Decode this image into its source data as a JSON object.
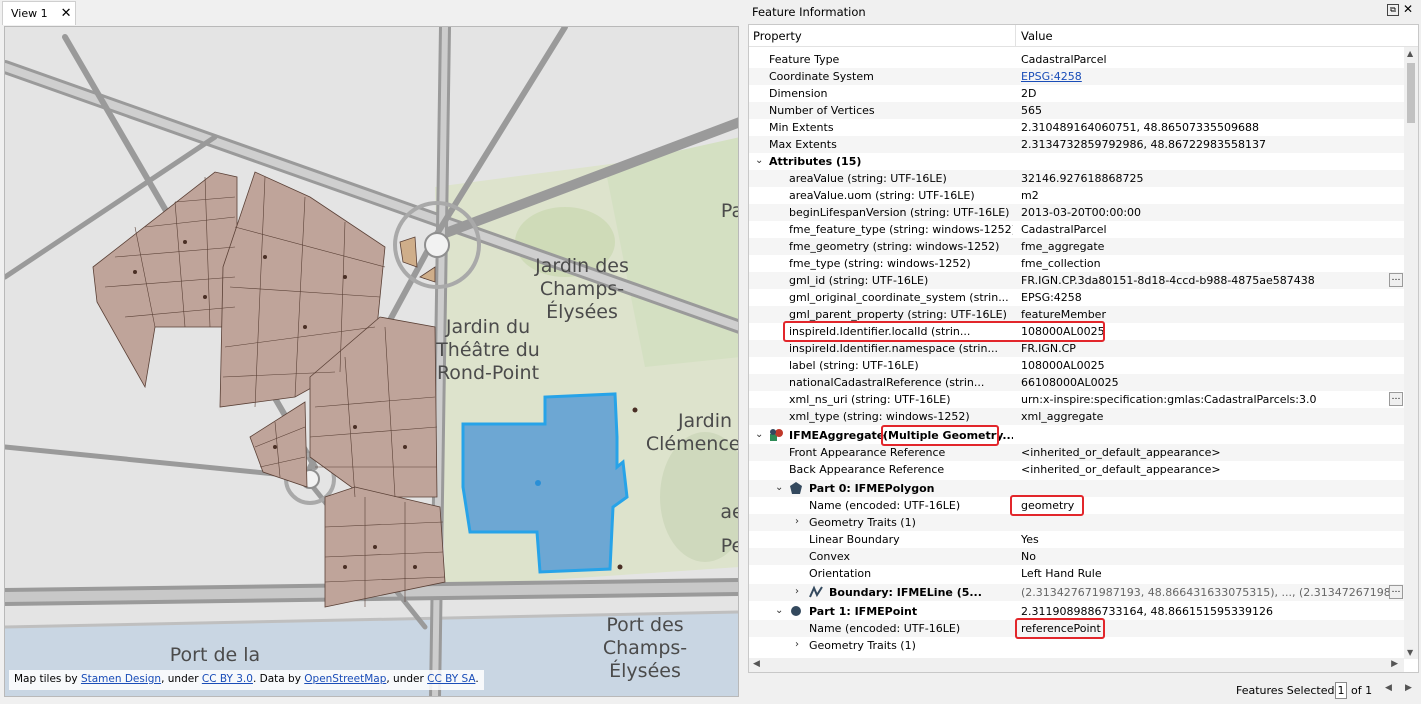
{
  "view_tab": {
    "label": "View 1"
  },
  "map": {
    "labels": {
      "jardin_champs": [
        "Jardin des",
        "Champs-",
        "Élysées"
      ],
      "jardin_theatre": [
        "Jardin du",
        "Théâtre du",
        "Rond-Point"
      ],
      "jardin_clemenceau": [
        "Jardin",
        "Clémenceau"
      ],
      "port": [
        "Port des",
        "Champs-",
        "Élysées"
      ],
      "port_de_la": [
        "Port de la"
      ],
      "edge_pa": "Pa",
      "edge_ae": "ae",
      "edge_pe": "Pe"
    },
    "attribution": {
      "t1": "Map tiles by ",
      "l1": "Stamen Design",
      "t2": ", under ",
      "l2": "CC BY 3.0",
      "t3": ". Data by ",
      "l3": "OpenStreetMap",
      "t4": ", under ",
      "l4": "CC BY SA",
      "t5": "."
    },
    "colors": {
      "parcel": "#bfa49a",
      "selected": "#6da7d3",
      "selected_outline": "#27a3e8"
    }
  },
  "panel": {
    "title": "Feature Information",
    "col_property": "Property",
    "col_value": "Value",
    "rows": [
      {
        "prop": "Feature Type",
        "val": "CadastralParcel"
      },
      {
        "prop": "Coordinate System",
        "val": "EPSG:4258",
        "link": true
      },
      {
        "prop": "Dimension",
        "val": "2D"
      },
      {
        "prop": "Number of Vertices",
        "val": "565"
      },
      {
        "prop": "Min Extents",
        "val": "2.310489164060751, 48.86507335509688"
      },
      {
        "prop": "Max Extents",
        "val": "2.3134732859792986, 48.86722983558137"
      },
      {
        "prop": "Attributes (15)",
        "val": "",
        "bold": true,
        "expand": true
      },
      {
        "prop": "areaValue (string: UTF-16LE)",
        "val": "32146.927618868725"
      },
      {
        "prop": "areaValue.uom (string: UTF-16LE)",
        "val": "m2"
      },
      {
        "prop": "beginLifespanVersion (string: UTF-16LE)",
        "val": "2013-03-20T00:00:00"
      },
      {
        "prop": "fme_feature_type (string: windows-1252)",
        "val": "CadastralParcel"
      },
      {
        "prop": "fme_geometry (string: windows-1252)",
        "val": "fme_aggregate"
      },
      {
        "prop": "fme_type (string: windows-1252)",
        "val": "fme_collection"
      },
      {
        "prop": "gml_id (string: UTF-16LE)",
        "val": "FR.IGN.CP.3da80151-8d18-4ccd-b988-4875ae587438",
        "btn": true
      },
      {
        "prop": "gml_original_coordinate_system (strin...",
        "val": "EPSG:4258"
      },
      {
        "prop": "gml_parent_property (string: UTF-16LE)",
        "val": "featureMember"
      },
      {
        "prop": "inspireId.Identifier.localId (strin...",
        "val": "108000AL0025"
      },
      {
        "prop": "inspireId.Identifier.namespace (strin...",
        "val": "FR.IGN.CP"
      },
      {
        "prop": "label (string: UTF-16LE)",
        "val": "108000AL0025"
      },
      {
        "prop": "nationalCadastralReference (strin...",
        "val": "66108000AL0025"
      },
      {
        "prop": "xml_ns_uri (string: UTF-16LE)",
        "val": "urn:x-inspire:specification:gmlas:CadastralParcels:3.0",
        "btn": true
      },
      {
        "prop": "xml_type (string: windows-1252)",
        "val": "xml_aggregate"
      },
      {
        "prop": "IFMEAggregate",
        "prop2": "(Multiple Geometry...",
        "val": "",
        "bold": true,
        "expand": true,
        "icon": "aggregate"
      },
      {
        "prop": "Front Appearance Reference",
        "val": "<inherited_or_default_appearance>"
      },
      {
        "prop": "Back Appearance Reference",
        "val": "<inherited_or_default_appearance>"
      },
      {
        "prop": "Part 0: IFMEPolygon",
        "val": "",
        "bold": true,
        "expand": true,
        "icon": "polygon"
      },
      {
        "prop": "Name (encoded: UTF-16LE)",
        "val": "geometry"
      },
      {
        "prop": "Geometry Traits (1)",
        "val": "",
        "collapsed": true
      },
      {
        "prop": "Linear Boundary",
        "val": "Yes"
      },
      {
        "prop": "Convex",
        "val": "No"
      },
      {
        "prop": "Orientation",
        "val": "Left Hand Rule"
      },
      {
        "prop": "Boundary: IFMELine (5...",
        "val": "(2.313427671987193, 48.866431633075315), ..., (2.3134726719871...",
        "bold": true,
        "collapsed": true,
        "icon": "line",
        "btn": true,
        "muted": true
      },
      {
        "prop": "Part 1: IFMEPoint",
        "val": "2.3119089886733164, 48.866151595339126",
        "bold": true,
        "expand": true,
        "icon": "point"
      },
      {
        "prop": "Name (encoded: UTF-16LE)",
        "val": "referencePoint"
      },
      {
        "prop": "Geometry Traits (1)",
        "val": "",
        "collapsed": true
      }
    ],
    "footer": {
      "label": "Features Selected:",
      "page": "1",
      "of": "of 1"
    }
  }
}
